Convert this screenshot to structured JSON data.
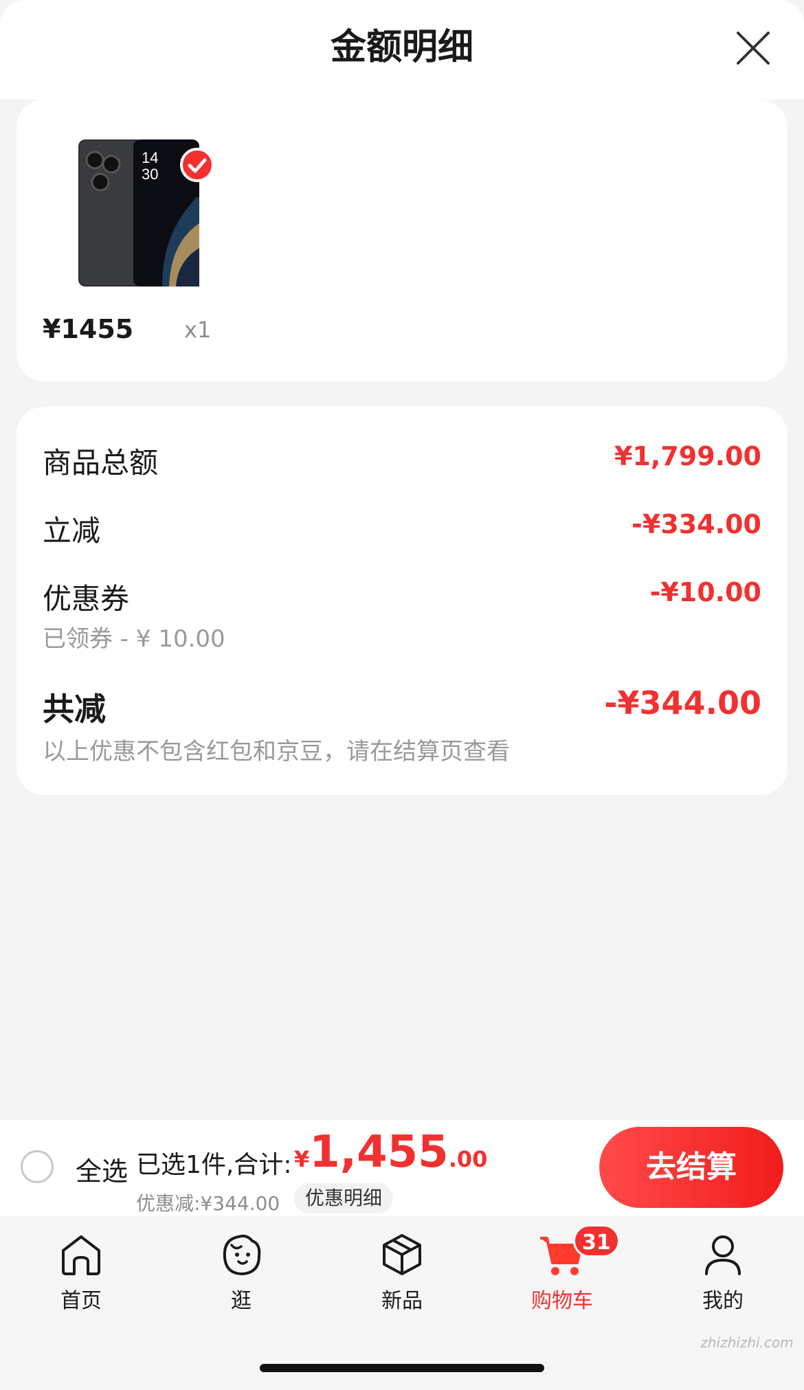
{
  "header": {
    "title": "金额明细"
  },
  "product": {
    "price": "¥1455",
    "quantity": "x1",
    "thumbnail": {
      "clock_hour": "14",
      "clock_minute": "30"
    }
  },
  "summary": {
    "rows": [
      {
        "label": "商品总额",
        "value": "¥1,799.00"
      },
      {
        "label": "立减",
        "value": "-¥334.00"
      },
      {
        "label": "优惠券",
        "value": "-¥10.00",
        "sub": "已领券 - ¥ 10.00"
      },
      {
        "label": "共减",
        "value": "-¥344.00",
        "sub": "以上优惠不包含红包和京豆，请在结算页查看"
      }
    ]
  },
  "bottom_bar": {
    "select_all_label": "全选",
    "selected_summary": "已选1件,合计:",
    "total_yen": "¥",
    "total_int": "1,455",
    "total_dec": ".00",
    "discount_note": "优惠减:¥344.00",
    "discount_detail_label": "优惠明细",
    "checkout_label": "去结算"
  },
  "tabbar": {
    "tabs": [
      {
        "label": "首页",
        "icon": "home-icon"
      },
      {
        "label": "逛",
        "icon": "browse-icon"
      },
      {
        "label": "新品",
        "icon": "new-product-icon"
      },
      {
        "label": "购物车",
        "icon": "cart-icon",
        "active": true,
        "badge": "31"
      },
      {
        "label": "我的",
        "icon": "profile-icon"
      }
    ]
  },
  "watermark": "zhizhizhi.com",
  "colors": {
    "accent": "#f23030",
    "background": "#f4f4f4",
    "card": "#ffffff",
    "muted_text": "#999999"
  }
}
